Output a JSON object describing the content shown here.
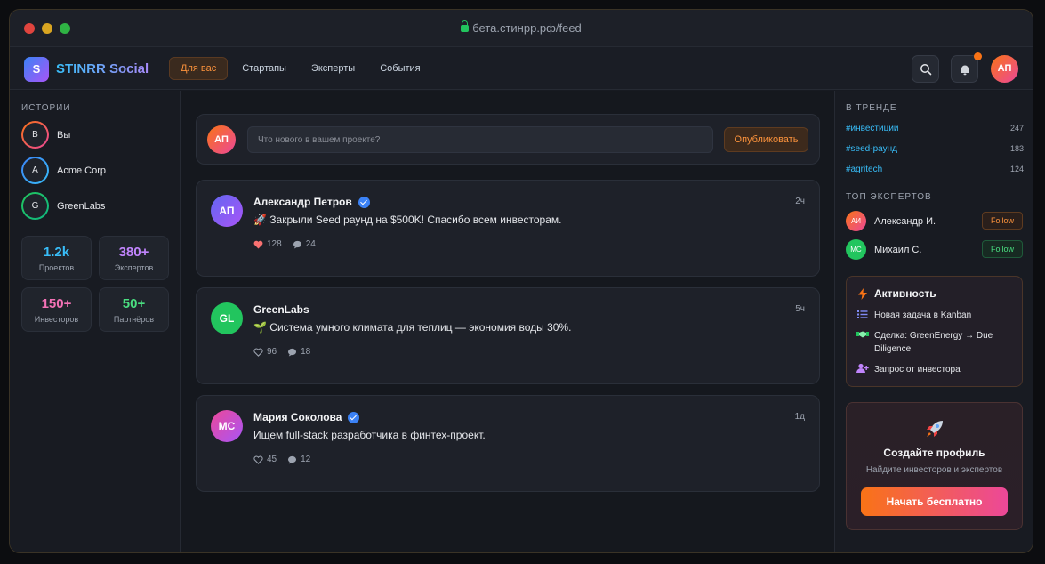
{
  "window": {
    "url": "бета.стинрр.рф/feed"
  },
  "nav": {
    "logo_letter": "S",
    "brand": "STINRR Social",
    "tabs": [
      "Для вас",
      "Стартапы",
      "Эксперты",
      "События"
    ],
    "active_tab": "Для вас",
    "user_initials": "АП",
    "icons": [
      "search-icon",
      "bell-icon"
    ],
    "accent": "#f97316"
  },
  "sidebar": {
    "stories_title": "ИСТОРИИ",
    "stories": [
      {
        "initial": "В",
        "label": "Вы"
      },
      {
        "initial": "A",
        "label": "Acme Corp"
      },
      {
        "initial": "G",
        "label": "GreenLabs"
      }
    ],
    "stats": [
      {
        "value": "1.2k",
        "label": "Проектов",
        "color": "#38bdf8"
      },
      {
        "value": "380+",
        "label": "Экспертов",
        "color": "#c084fc"
      },
      {
        "value": "150+",
        "label": "Инвесторов",
        "color": "#f472b6"
      },
      {
        "value": "50+",
        "label": "Партнёров",
        "color": "#4ade80"
      }
    ]
  },
  "composer": {
    "avatar": "АП",
    "placeholder": "Что нового в вашем проекте?",
    "button": "Опубликовать"
  },
  "posts": [
    {
      "initials": "АП",
      "name": "Александр Петров",
      "verified": true,
      "time": "2ч",
      "text": "🚀 Закрыли Seed раунд на $500K! Спасибо всем инвесторам.",
      "likes": "128",
      "comments": "24",
      "liked": true
    },
    {
      "initials": "GL",
      "name": "GreenLabs",
      "verified": false,
      "time": "5ч",
      "text": "🌱 Система умного климата для теплиц — экономия воды 30%.",
      "likes": "96",
      "comments": "18",
      "liked": false
    },
    {
      "initials": "МС",
      "name": "Мария Соколова",
      "verified": true,
      "time": "1д",
      "text": "Ищем full-stack разработчика в финтех-проект.",
      "likes": "45",
      "comments": "12",
      "liked": false
    }
  ],
  "right": {
    "trending_title": "В ТРЕНДЕ",
    "trending": [
      {
        "tag": "#инвестиции",
        "count": "247"
      },
      {
        "tag": "#seed-раунд",
        "count": "183"
      },
      {
        "tag": "#agritech",
        "count": "124"
      }
    ],
    "experts_title": "ТОП ЭКСПЕРТОВ",
    "experts": [
      {
        "initials": "АИ",
        "name": "Александр И.",
        "button": "Follow"
      },
      {
        "initials": "МС",
        "name": "Михаил С.",
        "button": "Follow"
      }
    ],
    "activity_title": "Активность",
    "activity": [
      {
        "icon": "list-icon",
        "text": "Новая задача в Kanban"
      },
      {
        "icon": "handshake-icon",
        "text": "Сделка: GreenEnergy → Due Diligence"
      },
      {
        "icon": "user-add-icon",
        "text": "Запрос от инвестора"
      }
    ],
    "cta": {
      "title": "Создайте профиль",
      "subtitle": "Найдите инвесторов и экспертов",
      "button": "Начать бесплатно"
    }
  }
}
